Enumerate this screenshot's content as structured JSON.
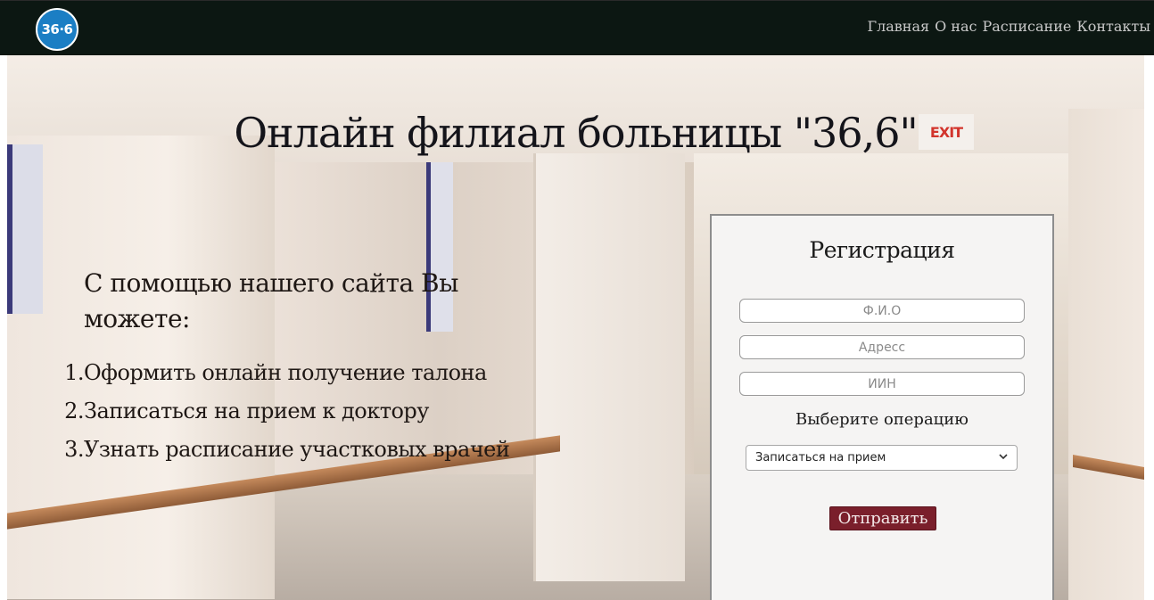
{
  "header": {
    "logo_text": "36·6",
    "nav": [
      "Главная",
      "О нас",
      "Расписание",
      "Контакты"
    ]
  },
  "hero": {
    "title": "Онлайн филиал больницы \"36,6\"",
    "exit_sign": "EXIT",
    "lead": "С помощью нашего сайта Вы можете:",
    "features": [
      "Оформить онлайн получение талона",
      "Записаться на прием к доктору",
      "Узнать расписание участковых врачей"
    ]
  },
  "registration": {
    "title": "Регистрация",
    "name_placeholder": "Ф.И.О",
    "address_placeholder": "Адресс",
    "iin_placeholder": "ИИН",
    "operation_label": "Выберите операцию",
    "operation_selected": "Записаться на прием",
    "submit_label": "Отправить"
  },
  "colors": {
    "header_bg": "#0c1712",
    "logo_bg": "#1b7ec4",
    "submit_bg": "#7a1f2b",
    "panel_bg": "#f5f4f3"
  }
}
